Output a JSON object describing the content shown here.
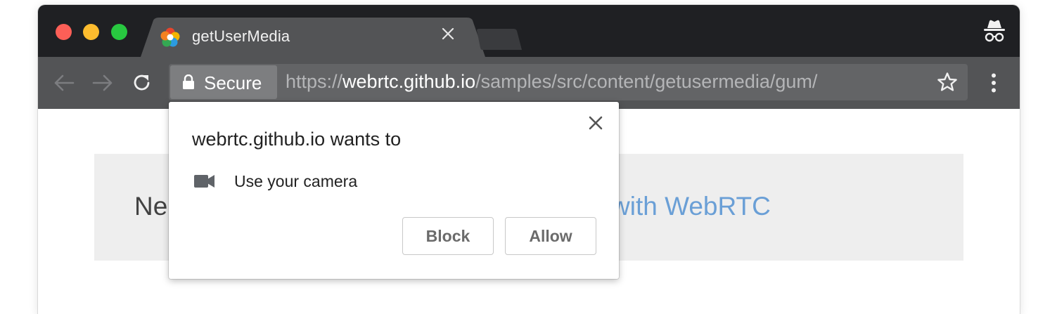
{
  "browser": {
    "tab": {
      "title": "getUserMedia",
      "favicon": "webrtc-logo-icon",
      "close_icon": "close-icon"
    },
    "toolbar": {
      "back_icon": "back-arrow-icon",
      "forward_icon": "forward-arrow-icon",
      "reload_icon": "reload-icon",
      "security_chip": {
        "icon": "lock-icon",
        "label": "Secure"
      },
      "url": {
        "scheme": "https://",
        "host": "webrtc.github.io",
        "path": "/samples/src/content/getusermedia/gum/"
      },
      "bookmark_icon": "star-icon",
      "menu_icon": "more-vert-icon"
    },
    "incognito_icon": "incognito-icon"
  },
  "page": {
    "banner_left": "Ne",
    "banner_right": "with WebRTC"
  },
  "permission_prompt": {
    "title": "webrtc.github.io wants to",
    "close_icon": "close-icon",
    "permission": {
      "icon": "videocam-icon",
      "label": "Use your camera"
    },
    "buttons": {
      "block": "Block",
      "allow": "Allow"
    }
  },
  "colors": {
    "tabstrip": "#1f2023",
    "toolbar": "#535456",
    "omnibox": "#636466",
    "link_blue": "#6a9fd6",
    "banner": "#eeeeee"
  }
}
